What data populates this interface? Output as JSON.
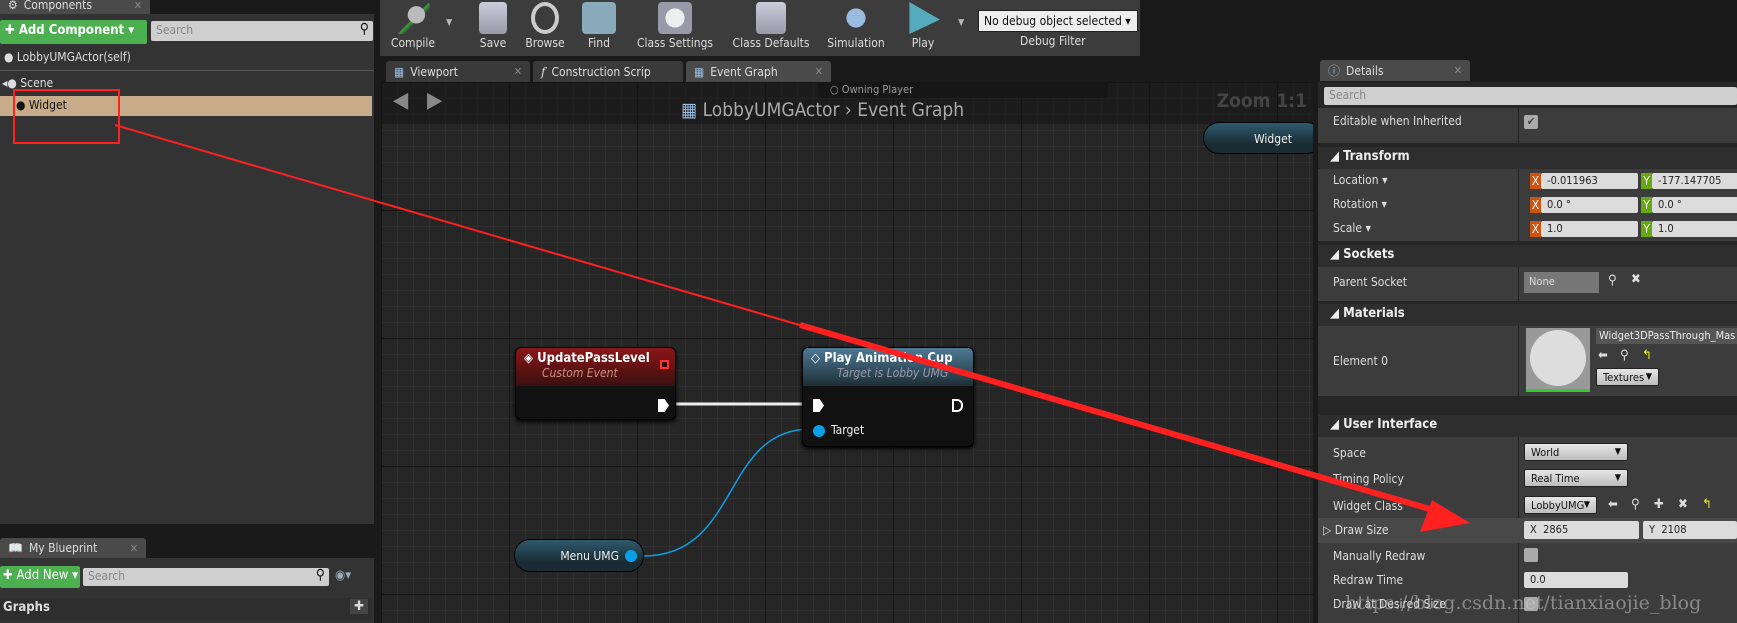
{
  "components": {
    "tab": "Components",
    "add_button": "Add Component",
    "search_placeholder": "Search",
    "tree": [
      {
        "label": "LobbyUMGActor(self)"
      },
      {
        "label": "Scene"
      },
      {
        "label": "Widget",
        "selected": true
      }
    ]
  },
  "toolbar": {
    "buttons": [
      "Compile",
      "Save",
      "Browse",
      "Find",
      "Class Settings",
      "Class Defaults",
      "Simulation",
      "Play"
    ],
    "debug_select": "No debug object selected",
    "debug_filter_label": "Debug Filter"
  },
  "editor_tabs": [
    {
      "label": "Viewport"
    },
    {
      "label": "Construction Scrip"
    },
    {
      "label": "Event Graph",
      "active": true
    }
  ],
  "graph": {
    "breadcrumb_actor": "LobbyUMGActor",
    "breadcrumb_graph": "Event Graph",
    "zoom": "Zoom 1:1",
    "faded_node": "Owning Player",
    "nodes": {
      "event": {
        "title": "UpdatePassLevel",
        "subtitle": "Custom Event"
      },
      "call": {
        "title": "Play Animation Cup",
        "subtitle": "Target is Lobby UMG",
        "pin": "Target"
      },
      "menu_var": "Menu UMG",
      "widget_var": "Widget"
    }
  },
  "my_blueprint": {
    "tab": "My Blueprint",
    "add_button": "Add New",
    "search_placeholder": "Search",
    "section": "Graphs"
  },
  "details": {
    "tab": "Details",
    "search_placeholder": "Search",
    "editable_label": "Editable when Inherited",
    "editable_checked": true,
    "transform": {
      "header": "Transform",
      "location_label": "Location",
      "location": [
        "-0.011963",
        "-177.147705"
      ],
      "rotation_label": "Rotation",
      "rotation": [
        "0.0 °",
        "0.0 °"
      ],
      "scale_label": "Scale",
      "scale": [
        "1.0",
        "1.0"
      ]
    },
    "sockets": {
      "header": "Sockets",
      "parent_label": "Parent Socket",
      "parent_value": "None"
    },
    "materials": {
      "header": "Materials",
      "element_label": "Element 0",
      "material": "Widget3DPassThrough_Mas",
      "textures": "Textures"
    },
    "ui": {
      "header": "User Interface",
      "space_label": "Space",
      "space": "World",
      "timing_label": "Timing Policy",
      "timing": "Real Time",
      "widget_class_label": "Widget Class",
      "widget_class": "LobbyUMG",
      "draw_size_label": "Draw Size",
      "draw_size": [
        "2865",
        "2108"
      ],
      "manual_label": "Manually Redraw",
      "manual": false,
      "redraw_label": "Redraw Time",
      "redraw": "0.0",
      "desired_label": "Draw at Desired Size",
      "desired": false
    }
  },
  "axis_labels": {
    "x": "X",
    "y": "Y"
  },
  "watermark": "https://blog.csdn.net/tianxiaojie_blog",
  "colors": {
    "selection": "#c8ab88",
    "annotation": "#ff2020",
    "accent_green": "#4caf50",
    "pin_blue": "#0aa0e8"
  }
}
